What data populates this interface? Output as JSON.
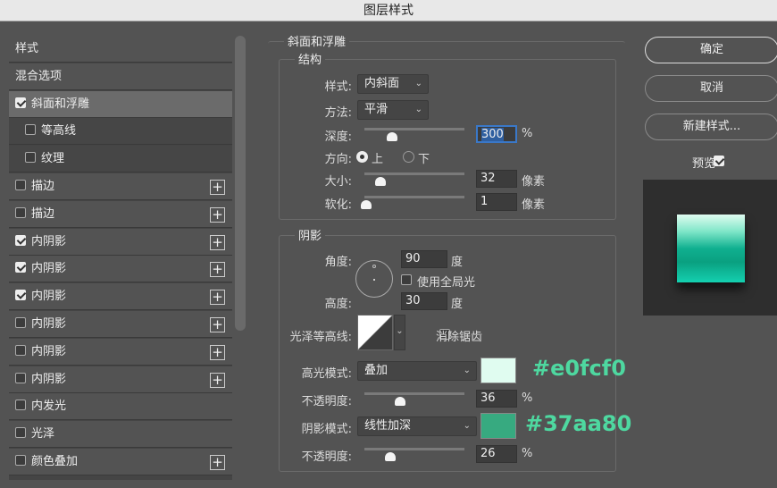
{
  "window": {
    "title": "图层样式"
  },
  "sidebar": {
    "items": [
      {
        "label": "样式",
        "checkbox": null,
        "plus": false
      },
      {
        "label": "混合选项",
        "checkbox": null,
        "plus": false
      },
      {
        "label": "斜面和浮雕",
        "checkbox": true,
        "plus": false,
        "selected": true
      },
      {
        "label": "等高线",
        "checkbox": false,
        "plus": false,
        "sub": true
      },
      {
        "label": "纹理",
        "checkbox": false,
        "plus": false,
        "sub": true
      },
      {
        "label": "描边",
        "checkbox": false,
        "plus": true
      },
      {
        "label": "描边",
        "checkbox": false,
        "plus": true
      },
      {
        "label": "内阴影",
        "checkbox": true,
        "plus": true
      },
      {
        "label": "内阴影",
        "checkbox": true,
        "plus": true
      },
      {
        "label": "内阴影",
        "checkbox": true,
        "plus": true
      },
      {
        "label": "内阴影",
        "checkbox": false,
        "plus": true
      },
      {
        "label": "内阴影",
        "checkbox": false,
        "plus": true
      },
      {
        "label": "内阴影",
        "checkbox": false,
        "plus": true
      },
      {
        "label": "内发光",
        "checkbox": false,
        "plus": false
      },
      {
        "label": "光泽",
        "checkbox": false,
        "plus": false
      },
      {
        "label": "颜色叠加",
        "checkbox": false,
        "plus": true
      }
    ],
    "plus_symbol": "+"
  },
  "bevel": {
    "title": "斜面和浮雕",
    "structure": {
      "title": "结构",
      "style_label": "样式:",
      "style_value": "内斜面",
      "technique_label": "方法:",
      "technique_value": "平滑",
      "depth_label": "深度:",
      "depth_value": "300",
      "depth_unit": "%",
      "depth_slider_pct": 28,
      "direction_label": "方向:",
      "direction_up": "上",
      "direction_down": "下",
      "direction_selected": "上",
      "size_label": "大小:",
      "size_value": "32",
      "size_unit": "像素",
      "size_slider_pct": 16,
      "soften_label": "软化:",
      "soften_value": "1",
      "soften_unit": "像素",
      "soften_slider_pct": 2
    },
    "shading": {
      "title": "阴影",
      "angle_label": "角度:",
      "angle_value": "90",
      "angle_unit": "度",
      "global_light_label": "使用全局光",
      "global_light": false,
      "altitude_label": "高度:",
      "altitude_value": "30",
      "altitude_unit": "度",
      "gloss_contour_label": "光泽等高线:",
      "anti_alias_label": "消除锯齿",
      "anti_alias": false,
      "highlight_mode_label": "高光模式:",
      "highlight_mode": "叠加",
      "highlight_color": "#e0fcf0",
      "highlight_hex": "#e0fcf0",
      "highlight_opacity_label": "不透明度:",
      "highlight_opacity": "36",
      "highlight_opacity_unit": "%",
      "highlight_slider_pct": 36,
      "shadow_mode_label": "阴影模式:",
      "shadow_mode": "线性加深",
      "shadow_color": "#37aa80",
      "shadow_hex": "#37aa80",
      "shadow_opacity_label": "不透明度:",
      "shadow_opacity": "26",
      "shadow_opacity_unit": "%",
      "shadow_slider_pct": 26
    }
  },
  "actions": {
    "ok": "确定",
    "cancel": "取消",
    "new_style": "新建样式...",
    "preview_label": "预览",
    "preview": true
  }
}
